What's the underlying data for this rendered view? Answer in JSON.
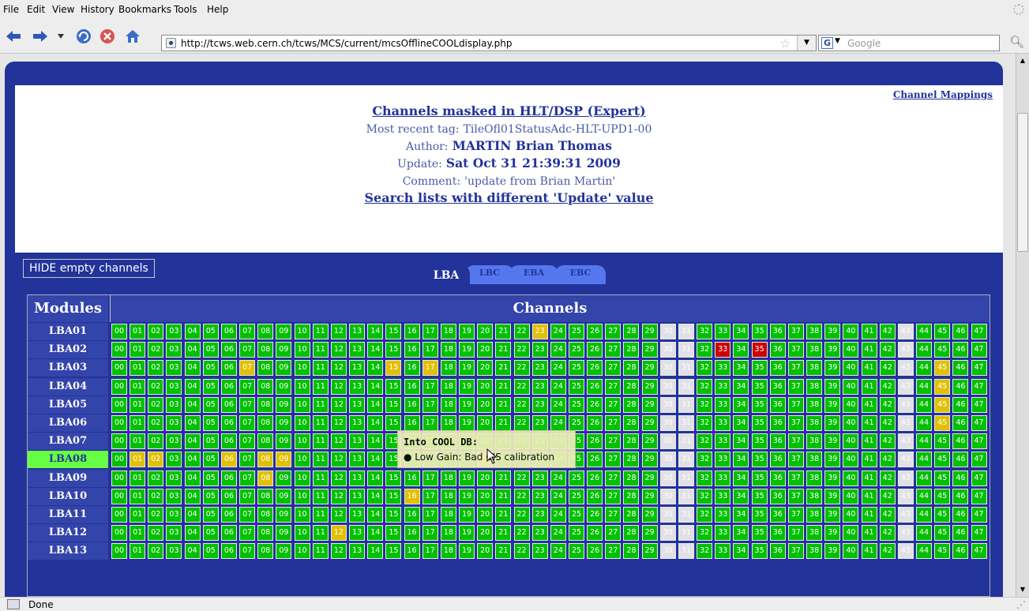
{
  "menu": [
    "File",
    "Edit",
    "View",
    "History",
    "Bookmarks",
    "Tools",
    "Help"
  ],
  "toolbar": {
    "url": "http://tcws.web.cern.ch/tcws/MCS/current/mcsOfflineCOOLdisplay.php",
    "search_placeholder": "Google",
    "search_engine": "G"
  },
  "header": {
    "channel_mappings": "Channel Mappings",
    "title": "Channels masked in HLT/DSP (Expert)",
    "tag_label": "Most recent tag:",
    "tag_value": "TileOfl01StatusAdc-HLT-UPD1-00",
    "author_label": "Author:",
    "author_value": "MARTIN Brian Thomas",
    "update_label": "Update:",
    "update_value": "Sat Oct 31 21:39:31 2009",
    "comment_label": "Comment:",
    "comment_value": "'update from Brian Martin'",
    "search_link": "Search lists with different 'Update' value"
  },
  "tabs": [
    "LBA",
    "LBC",
    "EBA",
    "EBC"
  ],
  "active_tab": "LBA",
  "hide_button": "HIDE empty channels",
  "table": {
    "modules_header": "Modules",
    "channels_header": "Channels",
    "rows": [
      {
        "module": "LBA01",
        "yellow": [
          23
        ],
        "red": []
      },
      {
        "module": "LBA02",
        "yellow": [],
        "red": [
          33,
          35
        ]
      },
      {
        "module": "LBA03",
        "yellow": [
          7,
          15,
          17,
          45
        ],
        "red": []
      },
      {
        "module": "LBA04",
        "yellow": [
          45
        ],
        "red": []
      },
      {
        "module": "LBA05",
        "yellow": [
          45
        ],
        "red": []
      },
      {
        "module": "LBA06",
        "yellow": [
          45
        ],
        "red": []
      },
      {
        "module": "LBA07",
        "yellow": [],
        "red": []
      },
      {
        "module": "LBA08",
        "yellow": [
          1,
          2,
          6,
          8,
          9,
          20
        ],
        "red": [],
        "selected": true
      },
      {
        "module": "LBA09",
        "yellow": [
          8
        ],
        "red": []
      },
      {
        "module": "LBA10",
        "yellow": [
          16
        ],
        "red": []
      },
      {
        "module": "LBA11",
        "yellow": [],
        "red": []
      },
      {
        "module": "LBA12",
        "yellow": [
          12
        ],
        "red": []
      },
      {
        "module": "LBA13",
        "yellow": [],
        "red": []
      }
    ],
    "empty_channels": [
      30,
      31,
      43
    ]
  },
  "tooltip": {
    "title": "Into COOL DB:",
    "item": "Low Gain: Bad CIS calibration"
  },
  "status": "Done",
  "colors": {
    "ok": "#00c000",
    "warn": "#e0c000",
    "bad": "#cc0000",
    "empty": "#e0e0e6",
    "selected_module": "#66ff44",
    "page_blue": "#223399"
  }
}
